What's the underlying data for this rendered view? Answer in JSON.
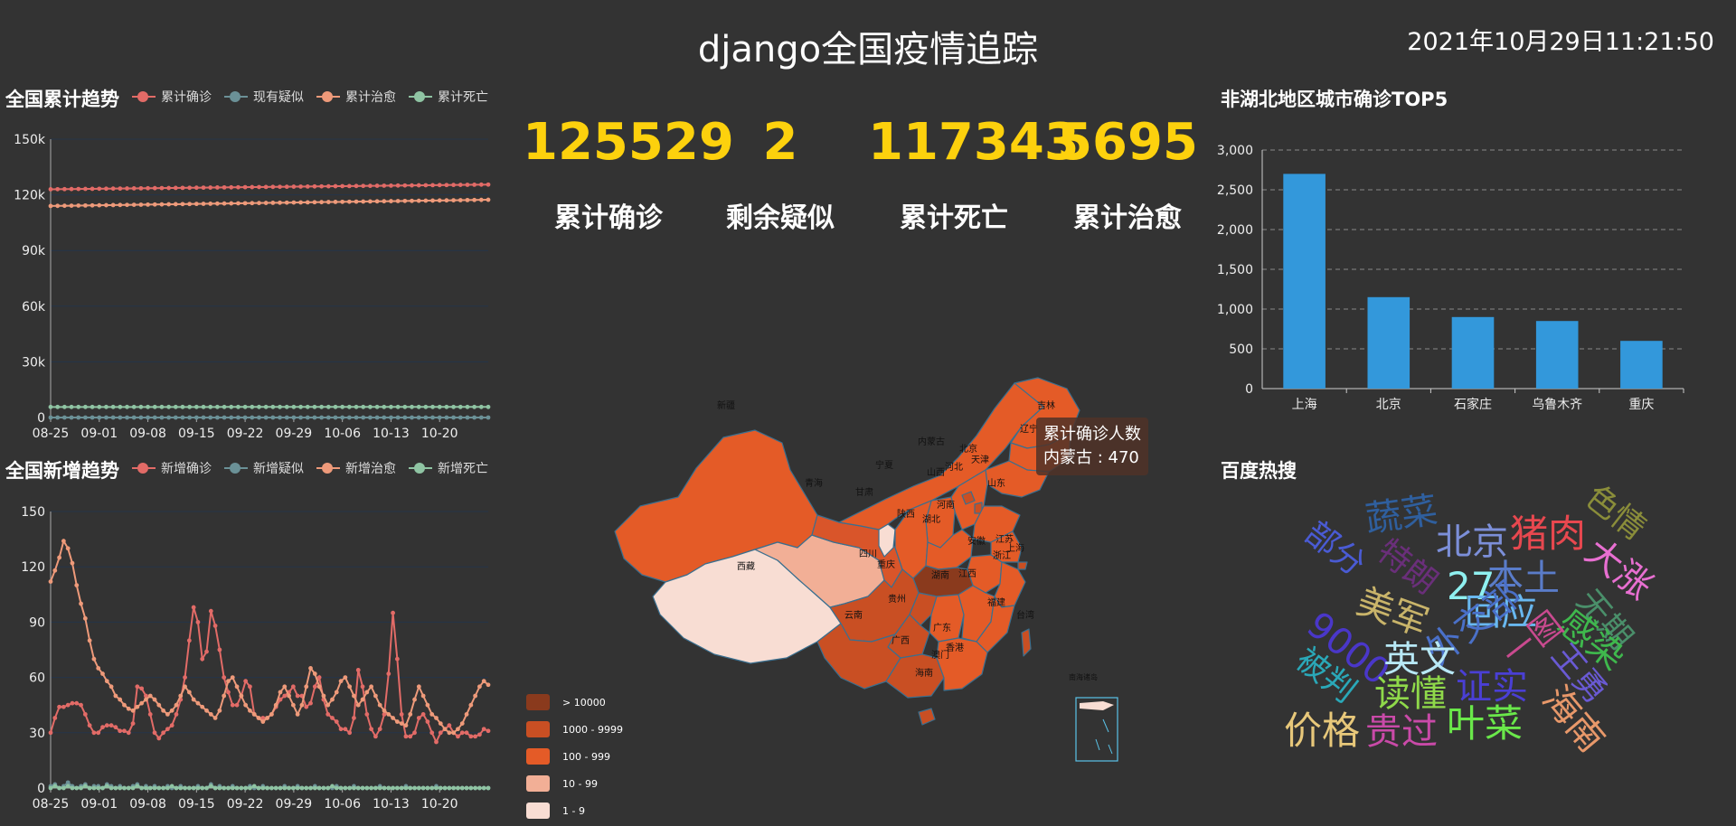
{
  "header": {
    "title": "django全国疫情追踪",
    "datetime": "2021年10月29日11:21:50"
  },
  "kpis": [
    {
      "value": "125529",
      "label": "累计确诊"
    },
    {
      "value": "2",
      "label": "剩余疑似"
    },
    {
      "value": "117343",
      "label": "累计死亡"
    },
    {
      "value": "5695",
      "label": "累计治愈"
    }
  ],
  "panels": {
    "cumulative_title": "全国累计趋势",
    "new_title": "全国新增趋势",
    "top5_title": "非湖北地区城市确诊TOP5",
    "hot_title": "百度热搜"
  },
  "chart_data": [
    {
      "type": "line",
      "title": "全国累计趋势",
      "x_labels": [
        "08-25",
        "09-01",
        "09-08",
        "09-15",
        "09-22",
        "09-29",
        "10-06",
        "10-13",
        "10-20"
      ],
      "x_start": "2021-08-25",
      "x_end": "2021-10-27",
      "y_ticks": [
        "0",
        "30k",
        "60k",
        "90k",
        "120k",
        "150k"
      ],
      "ylim": [
        0,
        150000
      ],
      "grid": true,
      "legend_position": "top",
      "series": [
        {
          "name": "累计确诊",
          "color": "#e26b67",
          "start": 123000,
          "end": 125529
        },
        {
          "name": "现有疑似",
          "color": "#6b9197",
          "start": 2,
          "end": 2
        },
        {
          "name": "累计治愈",
          "color": "#ee9a7a",
          "start": 114000,
          "end": 117343
        },
        {
          "name": "累计死亡",
          "color": "#8fc4a3",
          "start": 5690,
          "end": 5695
        }
      ]
    },
    {
      "type": "line",
      "title": "全国新增趋势",
      "x_labels": [
        "08-25",
        "09-01",
        "09-08",
        "09-15",
        "09-22",
        "09-29",
        "10-06",
        "10-13",
        "10-20"
      ],
      "x_start": "2021-08-25",
      "x_end": "2021-10-27",
      "y_ticks": [
        "0",
        "30",
        "60",
        "90",
        "120",
        "150"
      ],
      "ylim": [
        0,
        150
      ],
      "grid": true,
      "legend_position": "top",
      "series": [
        {
          "name": "新增确诊",
          "color": "#e26b67",
          "values": [
            30,
            38,
            44,
            44,
            45,
            46,
            46,
            45,
            40,
            34,
            30,
            30,
            33,
            34,
            34,
            33,
            31,
            31,
            30,
            35,
            55,
            54,
            50,
            40,
            30,
            27,
            30,
            32,
            34,
            40,
            48,
            60,
            80,
            98,
            90,
            70,
            74,
            96,
            88,
            75,
            60,
            52,
            45,
            45,
            50,
            58,
            55,
            40,
            38,
            38,
            38,
            40,
            44,
            48,
            50,
            52,
            55,
            50,
            50,
            44,
            46,
            55,
            60,
            48,
            40,
            38,
            36,
            32,
            32,
            30,
            38,
            64,
            55,
            40,
            32,
            28,
            32,
            40,
            62,
            95,
            70,
            40,
            28,
            28,
            30,
            38,
            40,
            36,
            30,
            25,
            30,
            32,
            34,
            30,
            28,
            30,
            30,
            28,
            28,
            29,
            32,
            31
          ]
        },
        {
          "name": "新增疑似",
          "color": "#6b9197",
          "values": [
            1,
            2,
            0,
            1,
            3,
            1,
            0,
            1,
            2,
            0,
            1,
            1,
            0,
            2,
            1,
            0,
            1,
            0,
            0,
            1,
            2,
            0,
            1,
            0,
            1,
            0,
            0,
            1,
            0,
            0,
            1,
            0,
            0,
            0,
            1,
            0,
            0,
            2,
            0,
            1,
            0,
            0,
            1,
            0,
            0,
            0,
            1,
            0,
            0,
            1,
            0,
            0,
            0,
            0,
            1,
            0,
            0,
            1,
            0,
            0,
            0,
            1,
            0,
            0,
            0,
            0,
            1,
            0,
            0,
            0,
            1,
            0,
            0,
            0,
            0,
            0,
            1,
            0,
            0,
            0,
            0,
            0,
            1,
            0,
            0,
            0,
            0,
            0,
            0,
            1,
            0,
            0,
            0,
            0,
            0,
            0,
            0,
            0,
            0,
            0,
            0,
            0
          ]
        },
        {
          "name": "新增治愈",
          "color": "#ee9a7a",
          "values": [
            112,
            118,
            125,
            134,
            130,
            122,
            110,
            100,
            92,
            80,
            70,
            65,
            62,
            58,
            55,
            50,
            48,
            45,
            43,
            42,
            44,
            46,
            48,
            50,
            48,
            45,
            42,
            40,
            42,
            45,
            50,
            55,
            52,
            48,
            46,
            44,
            42,
            40,
            38,
            42,
            50,
            58,
            60,
            55,
            50,
            45,
            42,
            40,
            38,
            36,
            38,
            40,
            45,
            52,
            55,
            50,
            45,
            40,
            45,
            55,
            65,
            62,
            55,
            50,
            45,
            48,
            52,
            58,
            60,
            55,
            50,
            45,
            48,
            52,
            55,
            50,
            45,
            42,
            40,
            38,
            36,
            35,
            34,
            40,
            48,
            55,
            50,
            45,
            40,
            38,
            35,
            32,
            30,
            30,
            32,
            35,
            40,
            45,
            50,
            55,
            58,
            56
          ]
        },
        {
          "name": "新增死亡",
          "color": "#8fc4a3",
          "values": [
            0,
            1,
            0,
            0,
            1,
            0,
            0,
            0,
            1,
            0,
            0,
            0,
            0,
            1,
            0,
            0,
            0,
            0,
            0,
            0,
            1,
            0,
            0,
            0,
            0,
            0,
            0,
            0,
            1,
            0,
            0,
            0,
            0,
            0,
            0,
            0,
            0,
            1,
            0,
            0,
            0,
            0,
            0,
            0,
            0,
            0,
            0,
            1,
            0,
            0,
            0,
            0,
            0,
            0,
            0,
            0,
            0,
            0,
            0,
            0,
            0,
            0,
            0,
            0,
            0,
            1,
            0,
            0,
            0,
            0,
            0,
            0,
            0,
            0,
            0,
            0,
            0,
            0,
            0,
            0,
            0,
            0,
            0,
            0,
            0,
            0,
            0,
            0,
            0,
            0,
            0,
            0,
            0,
            0,
            0,
            0,
            0,
            0,
            0,
            0,
            0,
            0
          ]
        }
      ]
    },
    {
      "type": "bar",
      "title": "非湖北地区城市确诊TOP5",
      "categories": [
        "上海",
        "北京",
        "石家庄",
        "乌鲁木齐",
        "重庆"
      ],
      "values": [
        2700,
        1150,
        900,
        850,
        600
      ],
      "y_ticks": [
        "0",
        "500",
        "1,000",
        "1,500",
        "2,000",
        "2,500",
        "3,000"
      ],
      "ylim": [
        0,
        3000
      ],
      "grid": true,
      "bar_color": "#3398DB"
    }
  ],
  "map": {
    "tooltip_title": "累计确诊人数",
    "tooltip_value": "内蒙古 : 470",
    "legend": [
      {
        "label": "> 10000",
        "color": "#8a3a1d"
      },
      {
        "label": "1000 - 9999",
        "color": "#c94f23"
      },
      {
        "label": "100 - 999",
        "color": "#e45b27"
      },
      {
        "label": "10 - 99",
        "color": "#f2af96"
      },
      {
        "label": "1 - 9",
        "color": "#f8ddd3"
      }
    ],
    "province_labels": [
      "新疆",
      "西藏",
      "青海",
      "甘肃",
      "宁夏",
      "内蒙古",
      "山西",
      "河北",
      "北京",
      "天津",
      "辽宁",
      "吉林",
      "山东",
      "河南",
      "陕西",
      "四川",
      "重庆",
      "湖北",
      "安徽",
      "江苏",
      "上海",
      "浙江",
      "湖南",
      "江西",
      "贵州",
      "云南",
      "广西",
      "广东",
      "福建",
      "台湾",
      "香港",
      "澳门",
      "海南",
      "南海诸岛"
    ]
  },
  "wordcloud": [
    {
      "text": "蔬菜",
      "color": "#2f5f9e",
      "size": 40
    },
    {
      "text": "北京",
      "color": "#7c8fd9",
      "size": 40
    },
    {
      "text": "猪肉",
      "color": "#e8484f",
      "size": 42
    },
    {
      "text": "色情",
      "color": "#8a8d3a",
      "size": 36
    },
    {
      "text": "部分",
      "color": "#4a5bd4",
      "size": 36
    },
    {
      "text": "特朗",
      "color": "#6a2f7a",
      "size": 36
    },
    {
      "text": "27",
      "color": "#8ff0f0",
      "size": 42
    },
    {
      "text": "本土",
      "color": "#5a7cc9",
      "size": 40
    },
    {
      "text": "大涨",
      "color": "#e86fd1",
      "size": 40
    },
    {
      "text": "美军",
      "color": "#c9b46a",
      "size": 40
    },
    {
      "text": "回应",
      "color": "#69b8f0",
      "size": 40
    },
    {
      "text": "外交部",
      "color": "#4a70c8",
      "size": 40
    },
    {
      "text": "无期",
      "color": "#4a8f6a",
      "size": 36
    },
    {
      "text": "感染",
      "color": "#3fb84d",
      "size": 40
    },
    {
      "text": "9000",
      "color": "#4a37c9",
      "size": 40
    },
    {
      "text": "英文",
      "color": "#b7e8f5",
      "size": 40
    },
    {
      "text": "一图",
      "color": "#c94a8f",
      "size": 36
    },
    {
      "text": "被判",
      "color": "#2aa8b8",
      "size": 36
    },
    {
      "text": "读懂",
      "color": "#8fd94a",
      "size": 40
    },
    {
      "text": "证实",
      "color": "#4a3fd4",
      "size": 40
    },
    {
      "text": "王勇",
      "color": "#6a5ad4",
      "size": 36
    },
    {
      "text": "价格",
      "color": "#e8c87a",
      "size": 42
    },
    {
      "text": "贵过",
      "color": "#c94aa8",
      "size": 40
    },
    {
      "text": "叶菜",
      "color": "#6ae84a",
      "size": 42
    },
    {
      "text": "海南",
      "color": "#e8986a",
      "size": 40
    }
  ]
}
